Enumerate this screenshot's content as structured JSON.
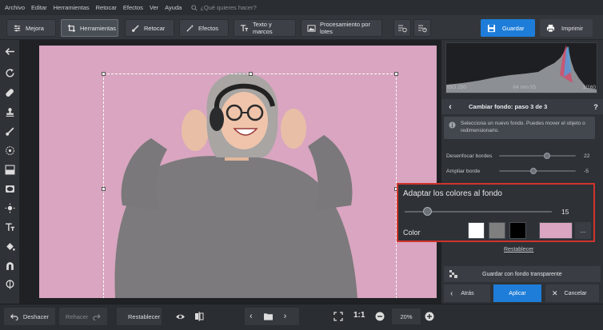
{
  "menu": {
    "items": [
      "Archivo",
      "Editar",
      "Herramientas",
      "Retocar",
      "Efectos",
      "Ver",
      "Ayuda"
    ],
    "search_placeholder": "¿Qué quieres hacer?"
  },
  "toolbar": {
    "tabs": [
      {
        "label": "Mejora",
        "icon": "sliders-icon"
      },
      {
        "label": "Herramientas",
        "icon": "crop-icon"
      },
      {
        "label": "Retocar",
        "icon": "brush-icon"
      },
      {
        "label": "Efectos",
        "icon": "magic-wand-icon"
      },
      {
        "label": "Texto y marcos",
        "icon": "text-icon"
      },
      {
        "label": "Procesamiento por lotes",
        "icon": "image-stack-icon"
      }
    ],
    "active_tab": "Herramientas",
    "save_label": "Guardar",
    "print_label": "Imprimir"
  },
  "camera": {
    "iso": "ISO 250",
    "lens": "64 mm f/5",
    "shutter": "1/160"
  },
  "panel": {
    "step_title": "Cambiar fondo: paso 3 de 3",
    "info_text": "Selecciona un nuevo fondo. Puedes mover el objeto o redimensionarlo.",
    "blur_label": "Desenfocar bordes",
    "blur_value": "22",
    "blur_level": 0.62,
    "expand_label": "Ampliar borde",
    "expand_value": "-5",
    "expand_level": 0.45,
    "adapt_label": "Adaptar los colores al fondo",
    "adapt_value": "15",
    "adapt_level": 0.15,
    "color_label": "Color",
    "swatches": [
      "#ffffff",
      "#7f7f7f",
      "#000000",
      "#d9a5c0"
    ],
    "more_label": "...",
    "reset_link": "Restablecer",
    "save_transparent": "Guardar con fondo transparente",
    "back_label": "Atrás",
    "apply_label": "Aplicar",
    "cancel_label": "Cancelar"
  },
  "bottom": {
    "undo_label": "Deshacer",
    "redo_label": "Rehacer",
    "reset_label": "Restablecer",
    "ratio_label": "1:1",
    "zoom_value": "20%"
  },
  "colors": {
    "accent": "#1e7dd8",
    "background_fill": "#d9a5c0",
    "highlight_border": "#d0342c"
  }
}
